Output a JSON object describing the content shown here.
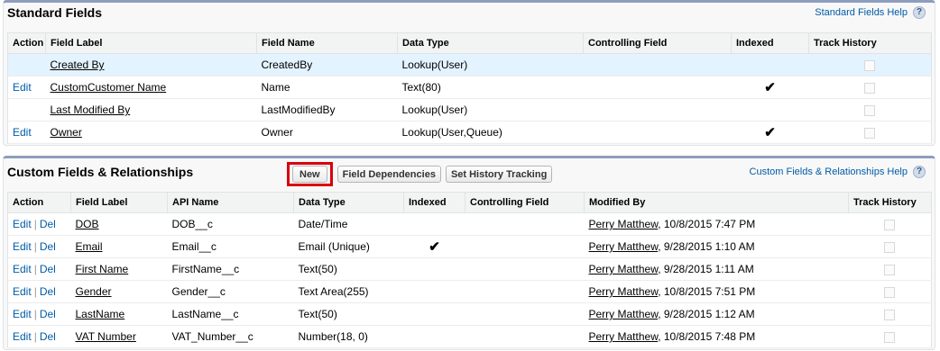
{
  "standard": {
    "title": "Standard Fields",
    "help_label": "Standard Fields Help",
    "help_icon": "question-icon",
    "columns": [
      "Action",
      "Field Label",
      "Field Name",
      "Data Type",
      "Controlling Field",
      "Indexed",
      "Track History"
    ],
    "rows": [
      {
        "action": "",
        "label": "Created By",
        "name": "CreatedBy",
        "type": "Lookup(User)",
        "controlling": "",
        "indexed": "",
        "highlight": true
      },
      {
        "action": "Edit",
        "label": "CustomCustomer Name",
        "name": "Name",
        "type": "Text(80)",
        "controlling": "",
        "indexed": "✔",
        "highlight": false
      },
      {
        "action": "",
        "label": "Last Modified By",
        "name": "LastModifiedBy",
        "type": "Lookup(User)",
        "controlling": "",
        "indexed": "",
        "highlight": false
      },
      {
        "action": "Edit",
        "label": "Owner",
        "name": "Owner",
        "type": "Lookup(User,Queue)",
        "controlling": "",
        "indexed": "✔",
        "highlight": false
      }
    ]
  },
  "custom": {
    "title": "Custom Fields & Relationships",
    "help_label": "Custom Fields & Relationships Help",
    "help_icon": "question-icon",
    "buttons": {
      "new": "New",
      "field_dependencies": "Field Dependencies",
      "set_history_tracking": "Set History Tracking"
    },
    "columns": [
      "Action",
      "Field Label",
      "API Name",
      "Data Type",
      "Indexed",
      "Controlling Field",
      "Modified By",
      "Track History"
    ],
    "edit_label": "Edit",
    "del_label": "Del",
    "separator": "|",
    "rows": [
      {
        "label": "DOB",
        "api": "DOB__c",
        "type": "Date/Time",
        "indexed": "",
        "controlling": "",
        "modified_by": "Perry Matthew",
        "modified_date": ", 10/8/2015 7:47 PM"
      },
      {
        "label": "Email",
        "api": "Email__c",
        "type": "Email (Unique)",
        "indexed": "✔",
        "controlling": "",
        "modified_by": "Perry Matthew",
        "modified_date": ", 9/28/2015 1:10 AM"
      },
      {
        "label": "First Name",
        "api": "FirstName__c",
        "type": "Text(50)",
        "indexed": "",
        "controlling": "",
        "modified_by": "Perry Matthew",
        "modified_date": ", 9/28/2015 1:11 AM"
      },
      {
        "label": "Gender",
        "api": "Gender__c",
        "type": "Text Area(255)",
        "indexed": "",
        "controlling": "",
        "modified_by": "Perry Matthew",
        "modified_date": ", 10/8/2015 7:51 PM"
      },
      {
        "label": "LastName",
        "api": "LastName__c",
        "type": "Text(50)",
        "indexed": "",
        "controlling": "",
        "modified_by": "Perry Matthew",
        "modified_date": ", 9/28/2015 1:12 AM"
      },
      {
        "label": "VAT Number",
        "api": "VAT_Number__c",
        "type": "Number(18, 0)",
        "indexed": "",
        "controlling": "",
        "modified_by": "Perry Matthew",
        "modified_date": ", 10/8/2015 7:48 PM"
      }
    ]
  },
  "colors": {
    "panel_top_border": "#8e9dbe",
    "link": "#015ba7",
    "highlight_row": "#e3f3ff",
    "new_button_outline": "#d8000c"
  }
}
